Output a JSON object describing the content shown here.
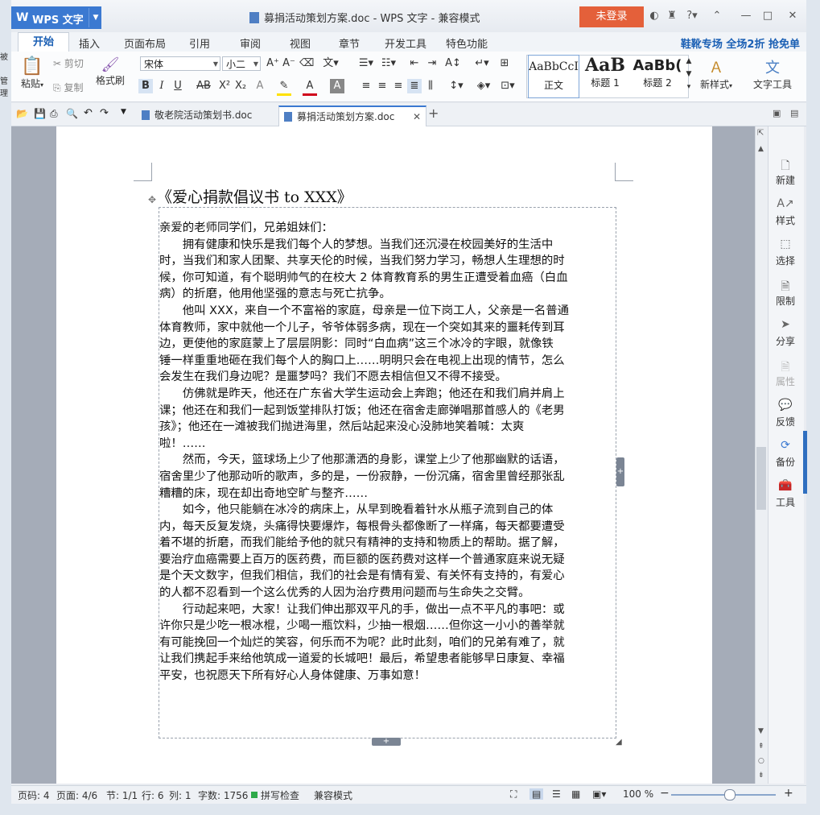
{
  "desktop": {
    "label1": "被",
    "label2": "管理"
  },
  "app": {
    "menu_button": "WPS 文字",
    "window_title": "募捐活动策划方案.doc - WPS 文字 - 兼容模式",
    "login": "未登录"
  },
  "ribbon_tabs": [
    "开始",
    "插入",
    "页面布局",
    "引用",
    "审阅",
    "视图",
    "章节",
    "开发工具",
    "特色功能"
  ],
  "promo": "鞋靴专场 全场2折 抢免单",
  "ribbon": {
    "paste": "粘贴",
    "cut": "剪切",
    "copy": "复制",
    "format_painter": "格式刷",
    "font_name": "宋体",
    "font_size": "小二",
    "styles": [
      {
        "preview": "AaBbCcI",
        "name": "正文"
      },
      {
        "preview": "AaB",
        "name": "标题 1"
      },
      {
        "preview": "AaBb(",
        "name": "标题 2"
      }
    ],
    "new_style": "新样式",
    "text_tools": "文字工具"
  },
  "doc_tabs": [
    {
      "label": "敬老院活动策划书.doc"
    },
    {
      "label": "募捐活动策划方案.doc"
    }
  ],
  "document": {
    "title": "《爱心捐款倡议书 to XXX》",
    "lines": [
      "亲爱的老师同学们，兄弟姐妹们：",
      "　　拥有健康和快乐是我们每个人的梦想。当我们还沉浸在校园美好的生活中",
      "时，当我们和家人团聚、共享天伦的时候，当我们努力学习，畅想人生理想的时",
      "候，你可知道，有个聪明帅气的在校大 2 体育教育系的男生正遭受着血癌（白血",
      "病）的折磨，他用他坚强的意志与死亡抗争。",
      "　　他叫 XXX，来自一个不富裕的家庭，母亲是一位下岗工人，父亲是一名普通",
      "体育教师，家中就他一个儿子，爷爷体弱多病，现在一个突如其来的噩耗传到耳",
      "边，更使他的家庭蒙上了层层阴影：同时“白血病”这三个冰冷的字眼，就像铁",
      "锤一样重重地砸在我们每个人的胸口上……明明只会在电视上出现的情节，怎么",
      "会发生在我们身边呢？是噩梦吗？我们不愿去相信但又不得不接受。",
      "　　仿佛就是昨天，他还在广东省大学生运动会上奔跑；他还在和我们肩并肩上",
      "课；他还在和我们一起到饭堂排队打饭；他还在宿舍走廊弹唱那首感人的《老男",
      "孩》；他还在一滩被我们抛进海里，然后站起来没心没肺地笑着喊：太爽",
      "啦！……",
      "　　然而，今天，篮球场上少了他那潇洒的身影，课堂上少了他那幽默的话语，",
      "宿舍里少了他那动听的歌声，多的是，一份寂静，一份沉痛，宿舍里曾经那张乱",
      "糟糟的床，现在却出奇地空旷与整齐……",
      "　　如今，他只能躺在冰冷的病床上，从早到晚看着针水从瓶子流到自己的体",
      "内，每天反复发烧，头痛得快要爆炸，每根骨头都像断了一样痛，每天都要遭受",
      "着不堪的折磨，而我们能给予他的就只有精神的支持和物质上的帮助。据了解，",
      "要治疗血癌需要上百万的医药费，而巨额的医药费对这样一个普通家庭来说无疑",
      "是个天文数字，但我们相信，我们的社会是有情有爱、有关怀有支持的，有爱心",
      "的人都不忍看到一个这么优秀的人因为治疗费用问题而与生命失之交臂。",
      "　　行动起来吧，大家！让我们伸出那双平凡的手，做出一点不平凡的事吧：或",
      "许你只是少吃一根冰棍，少喝一瓶饮料，少抽一根烟……但你这一小小的善举就",
      "有可能挽回一个灿烂的笑容，何乐而不为呢？此时此刻，咱们的兄弟有难了，就",
      "让我们携起手来给他筑成一道爱的长城吧！最后，希望患者能够早日康复、幸福",
      "平安，也祝愿天下所有好心人身体健康、万事如意！"
    ]
  },
  "side_panel": [
    "新建",
    "样式",
    "选择",
    "限制",
    "分享",
    "属性",
    "反馈",
    "备份",
    "工具"
  ],
  "status": {
    "page_code": "页码: 4",
    "pages": "页面: 4/6",
    "section": "节: 1/1",
    "row": "行: 6",
    "col": "列: 1",
    "word_count": "字数: 1756",
    "spell": "拼写检查",
    "compat": "兼容模式",
    "zoom": "100 %",
    "zoom_fraction": 0.55
  }
}
